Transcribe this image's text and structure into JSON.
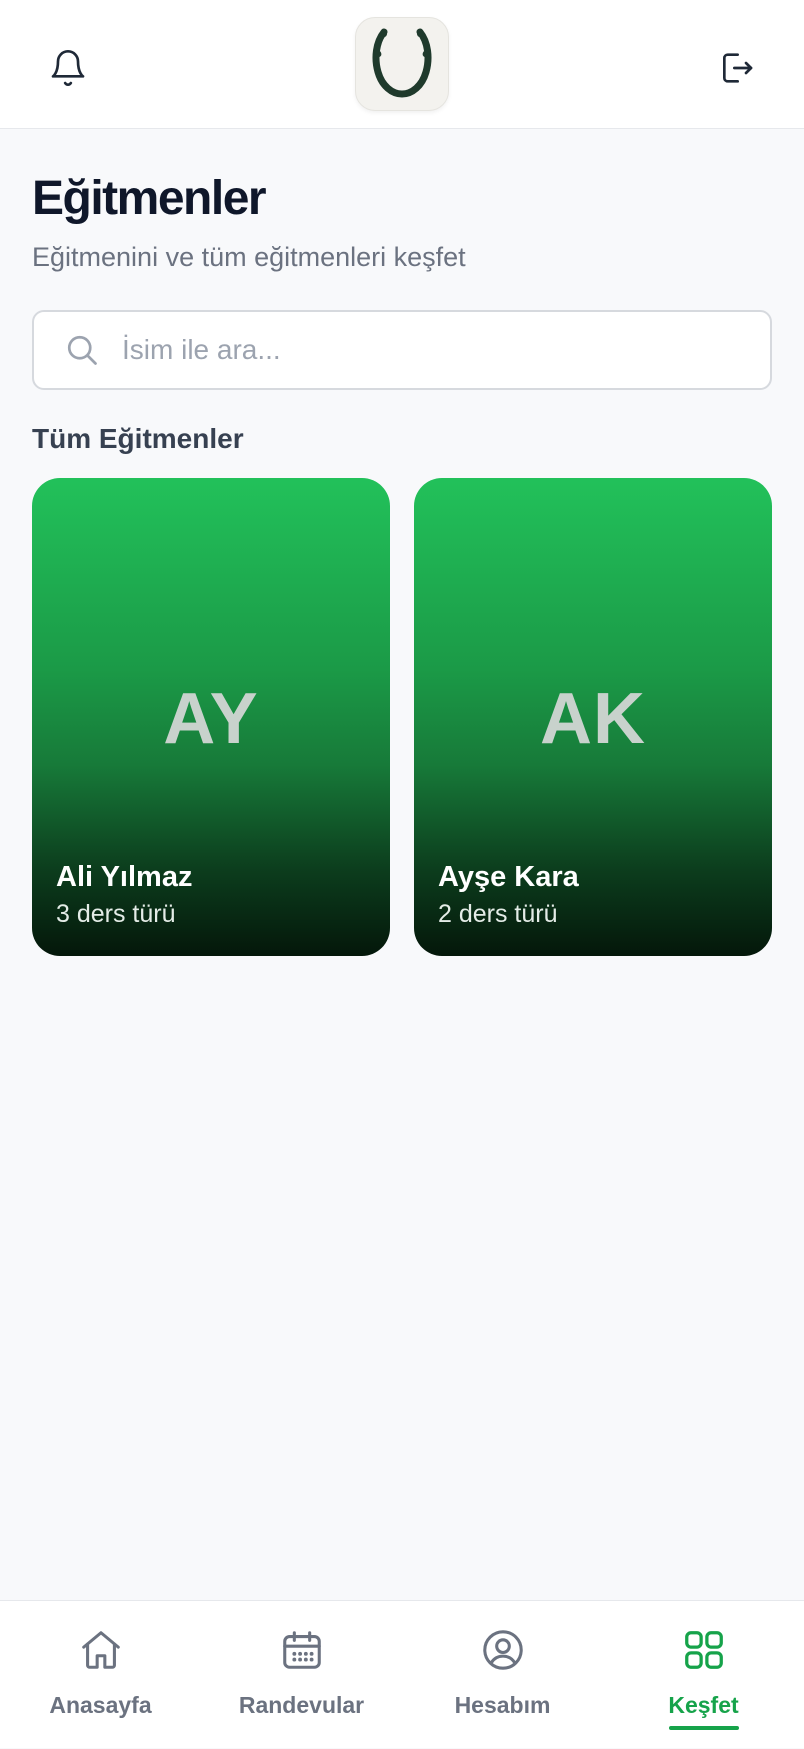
{
  "header": {
    "left_icon": "bell-icon",
    "right_icon": "logout-icon",
    "logo_icon": "horseshoe-logo-icon"
  },
  "page": {
    "title": "Eğitmenler",
    "subtitle": "Eğitmenini ve tüm eğitmenleri keşfet"
  },
  "search": {
    "placeholder": "İsim ile ara...",
    "value": "",
    "icon": "search-icon"
  },
  "section": {
    "title": "Tüm Eğitmenler"
  },
  "trainers": [
    {
      "initials": "AY",
      "name": "Ali Yılmaz",
      "lesson_count": "3 ders türü"
    },
    {
      "initials": "AK",
      "name": "Ayşe Kara",
      "lesson_count": "2 ders türü"
    }
  ],
  "nav": {
    "items": [
      {
        "label": "Anasayfa",
        "icon": "home-icon",
        "active": false
      },
      {
        "label": "Randevular",
        "icon": "calendar-icon",
        "active": false
      },
      {
        "label": "Hesabım",
        "icon": "user-circle-icon",
        "active": false
      },
      {
        "label": "Keşfet",
        "icon": "grid-icon",
        "active": true
      }
    ]
  },
  "colors": {
    "accent": "#16a34a",
    "card_top": "#22c15a",
    "card_bottom": "#04170a",
    "title": "#0f172a",
    "muted": "#6b7280",
    "background": "#f8f9fb"
  }
}
